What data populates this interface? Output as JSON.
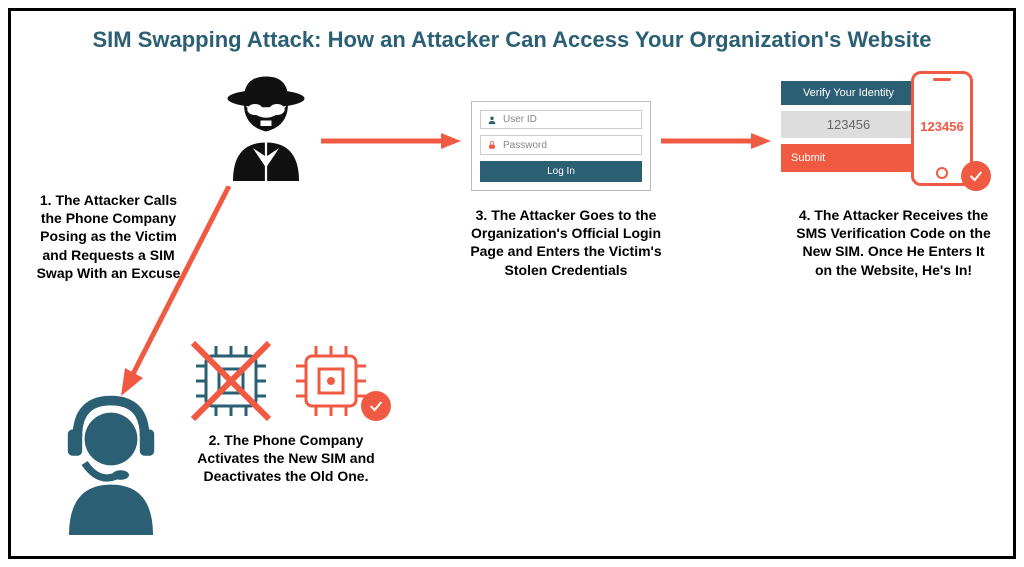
{
  "title": "SIM Swapping Attack: How an Attacker Can Access Your Organization's Website",
  "steps": {
    "s1": "1. The Attacker Calls the Phone Company Posing as the Victim and Requests a SIM Swap With an Excuse",
    "s2": "2. The Phone Company Activates the New SIM and Deactivates the Old One.",
    "s3": "3. The Attacker Goes to the Organization's Official Login Page and Enters the Victim's Stolen Credentials",
    "s4": "4. The Attacker Receives the SMS Verification Code on the New SIM. Once He Enters It on the Website, He's In!"
  },
  "login": {
    "userid_placeholder": "User ID",
    "password_placeholder": "Password",
    "button": "Log In"
  },
  "verify": {
    "header": "Verify Your Identity",
    "code": "123456",
    "submit": "Submit"
  },
  "phone_code": "123456",
  "colors": {
    "accent": "#f15a42",
    "teal": "#2b5f73"
  }
}
